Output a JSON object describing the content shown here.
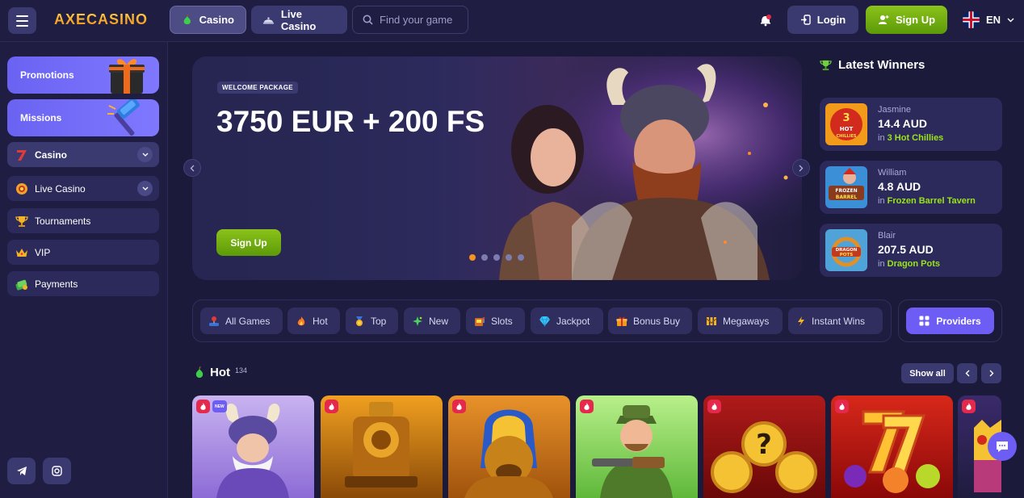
{
  "header": {
    "logo": "AXECASINO",
    "nav": [
      {
        "label": "Casino",
        "icon": "pear-icon"
      },
      {
        "label": "Live Casino",
        "icon": "cloche-icon"
      }
    ],
    "search_placeholder": "Find your game",
    "login_label": "Login",
    "signup_label": "Sign Up",
    "language": "EN"
  },
  "sidebar": {
    "promo_cards": [
      {
        "label": "Promotions",
        "icon": "gift-box-icon"
      },
      {
        "label": "Missions",
        "icon": "hammer-icon"
      }
    ],
    "items": [
      {
        "label": "Casino",
        "icon": "seven-icon",
        "expandable": true
      },
      {
        "label": "Live Casino",
        "icon": "chip-icon",
        "expandable": true
      },
      {
        "label": "Tournaments",
        "icon": "trophy-icon"
      },
      {
        "label": "VIP",
        "icon": "crown-icon"
      },
      {
        "label": "Payments",
        "icon": "money-icon"
      }
    ],
    "social": [
      "telegram-icon",
      "instagram-icon"
    ]
  },
  "banner": {
    "badge": "WELCOME PACKAGE",
    "title": "3750 EUR + 200 FS",
    "button": "Sign Up",
    "slides": 5,
    "active_slide": 1
  },
  "winners": {
    "title": "Latest Winners",
    "items": [
      {
        "name": "Jasmine",
        "amount": "14.4 AUD",
        "prefix": "in",
        "game": "3 Hot Chillies"
      },
      {
        "name": "William",
        "amount": "4.8 AUD",
        "prefix": "in",
        "game": "Frozen Barrel Tavern"
      },
      {
        "name": "Blair",
        "amount": "207.5 AUD",
        "prefix": "in",
        "game": "Dragon Pots"
      }
    ]
  },
  "categories": [
    {
      "label": "All Games",
      "icon": "joystick-icon"
    },
    {
      "label": "Hot",
      "icon": "flame-icon"
    },
    {
      "label": "Top",
      "icon": "medal-icon"
    },
    {
      "label": "New",
      "icon": "sparkle-icon"
    },
    {
      "label": "Slots",
      "icon": "slot-machine-icon"
    },
    {
      "label": "Jackpot",
      "icon": "diamond-icon"
    },
    {
      "label": "Bonus Buy",
      "icon": "bonus-gift-icon"
    },
    {
      "label": "Megaways",
      "icon": "megaways-icon"
    },
    {
      "label": "Instant Wins",
      "icon": "lightning-icon"
    }
  ],
  "providers_label": "Providers",
  "hot_section": {
    "title": "Hot",
    "count": "134",
    "show_all": "Show all",
    "new_tag": "NEW"
  },
  "colors": {
    "background": "#1b1a3a",
    "accent_green": "#8bc21a",
    "accent_purple": "#6d5df5",
    "active_dot": "#f7931e",
    "winner_game": "#9be31c"
  }
}
